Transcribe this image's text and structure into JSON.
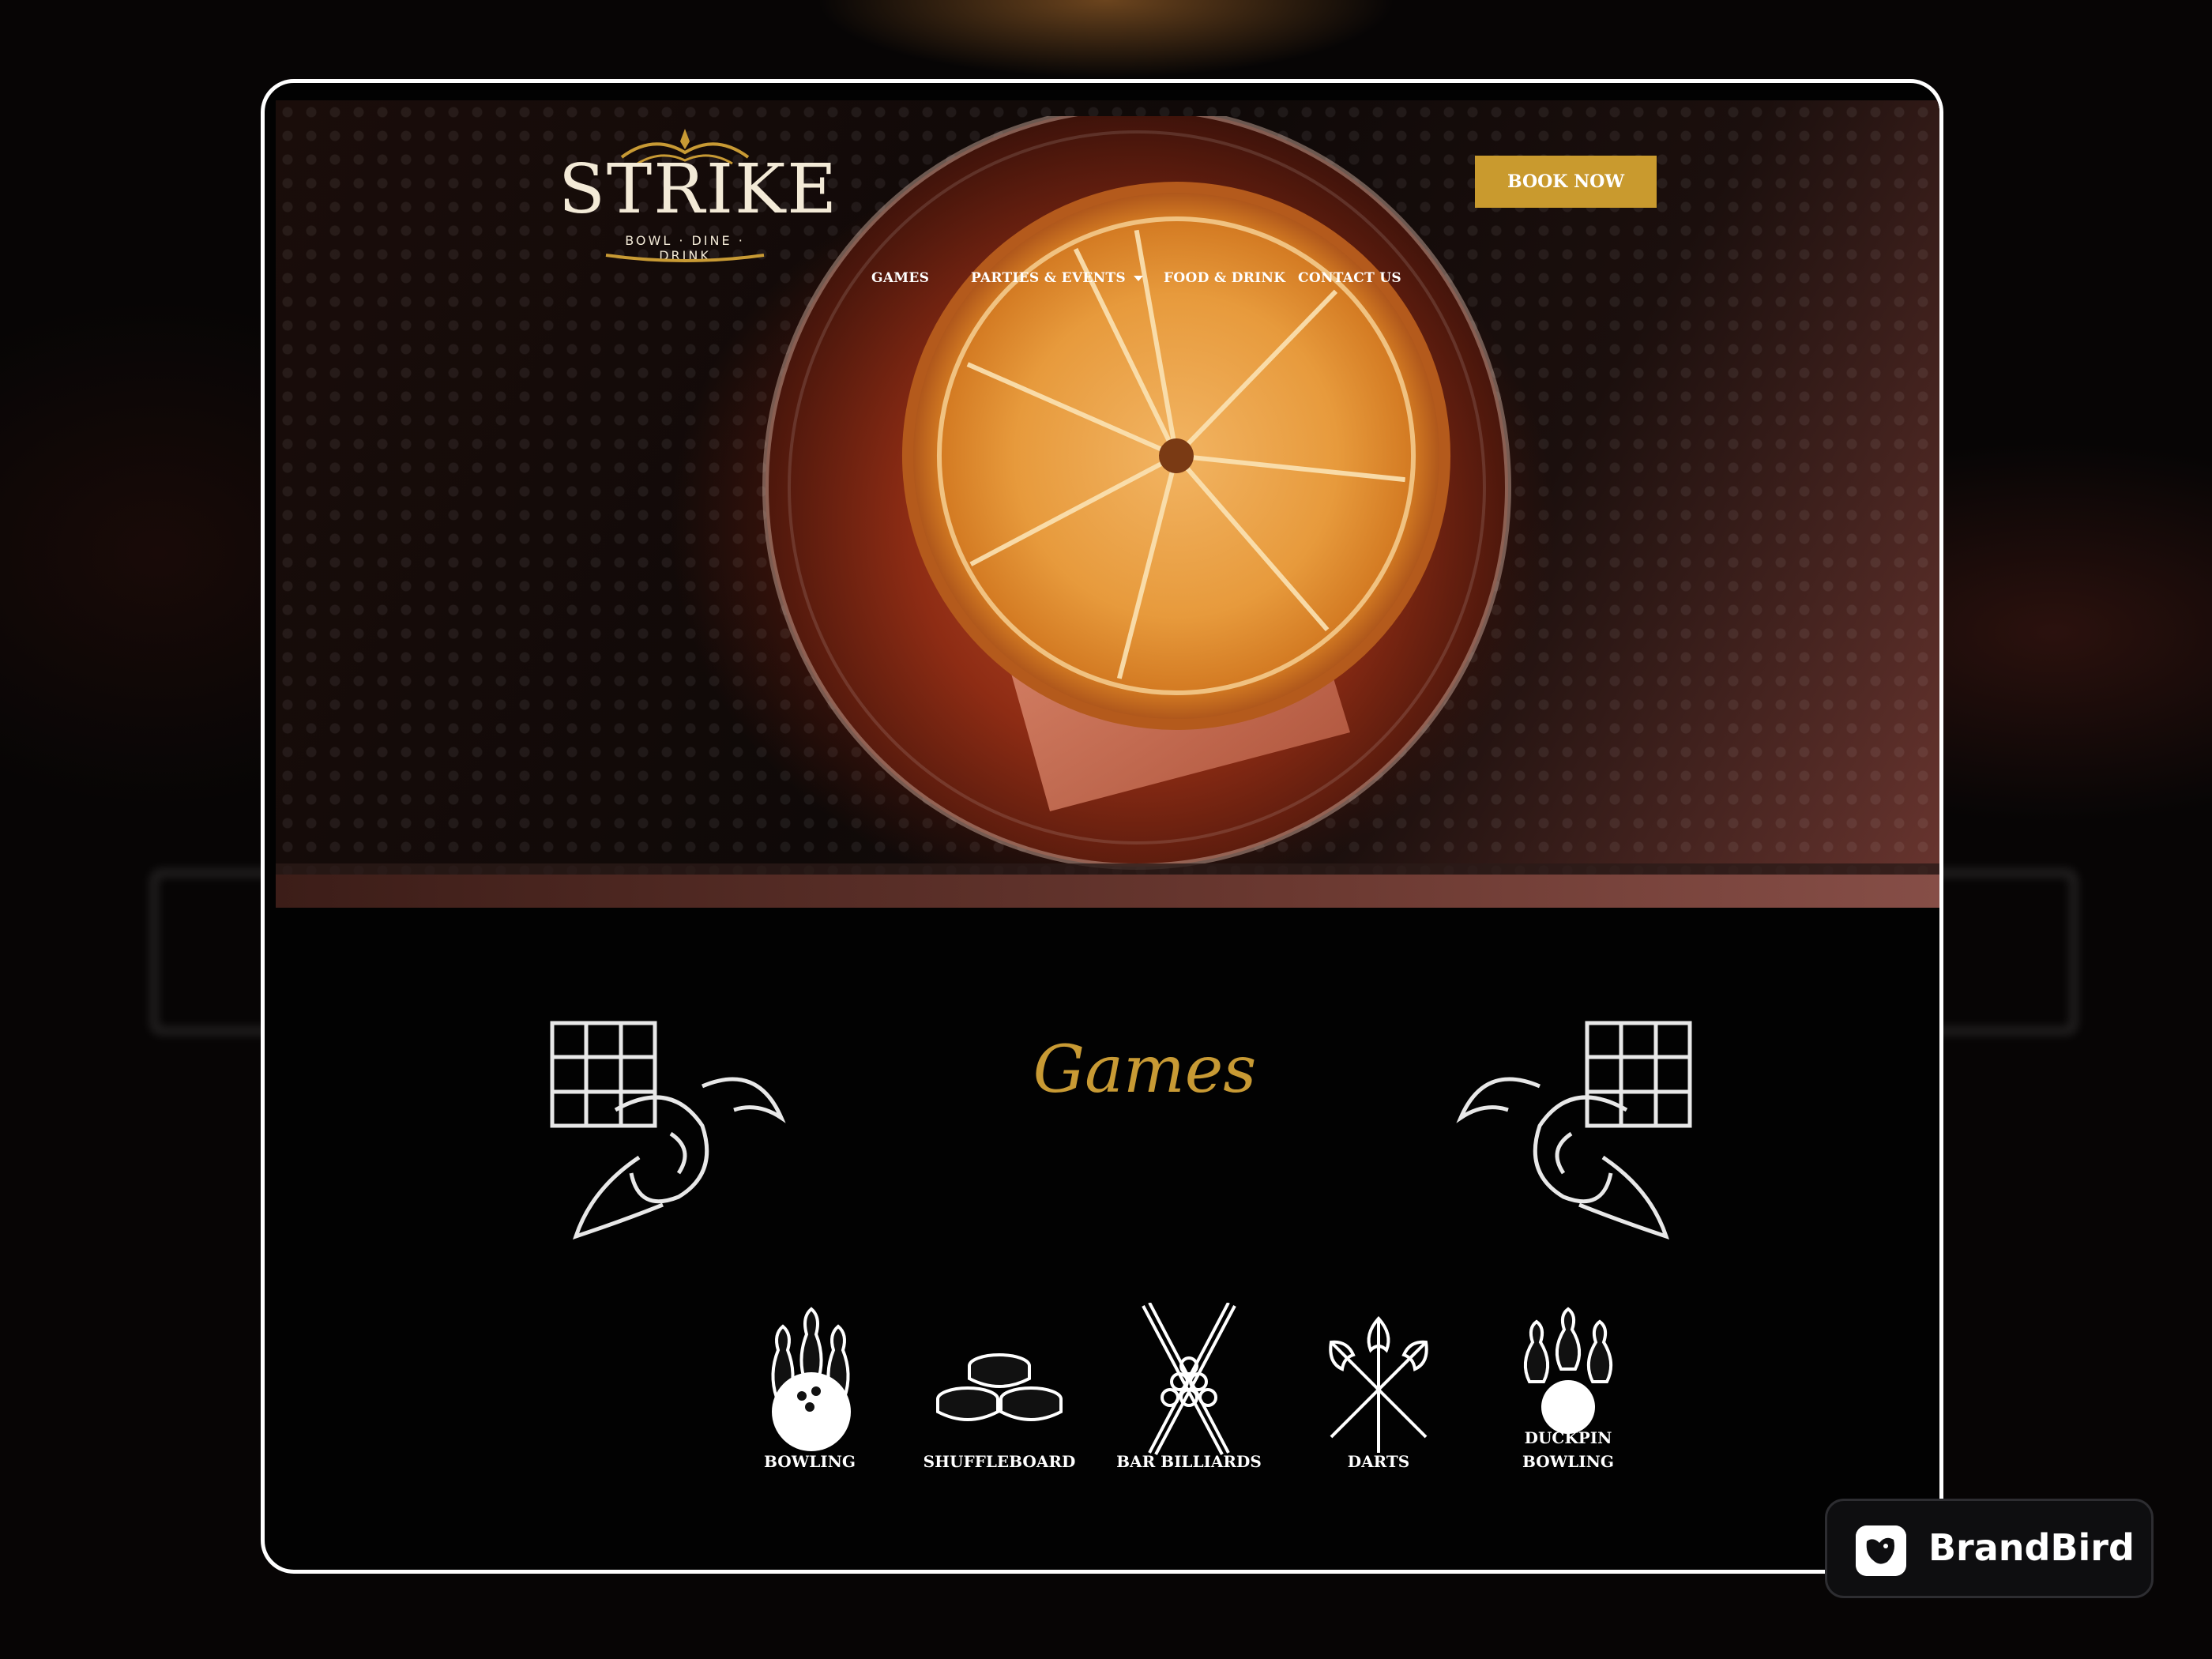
{
  "site": {
    "brand": {
      "name": "STRIKE",
      "tagline": "BOWL · DINE · DRINK"
    },
    "nav": [
      {
        "label": "GAMES"
      },
      {
        "label": "PARTIES & EVENTS",
        "has_dropdown": true
      },
      {
        "label": "FOOD & DRINK"
      },
      {
        "label": "CONTACT US"
      }
    ],
    "cta": {
      "label": "BOOK NOW"
    },
    "games_section": {
      "title": "Games",
      "items": [
        {
          "label": "BOWLING",
          "icon": "bowling-icon"
        },
        {
          "label": "SHUFFLEBOARD",
          "icon": "shuffleboard-icon"
        },
        {
          "label": "BAR BILLIARDS",
          "icon": "bar-billiards-icon"
        },
        {
          "label": "DARTS",
          "icon": "darts-icon"
        },
        {
          "label_line1": "DUCKPIN",
          "label_line2": "BOWLING",
          "icon": "duckpin-bowling-icon"
        }
      ]
    }
  },
  "badge": {
    "label": "BrandBird"
  },
  "colors": {
    "accent_gold": "#c99a2e",
    "title_gold": "#c89a34",
    "background": "#020202",
    "frame_border": "#ffffff"
  }
}
